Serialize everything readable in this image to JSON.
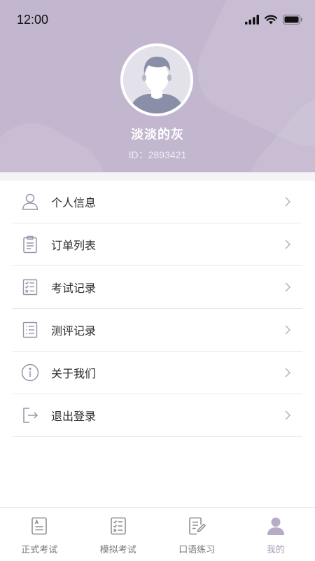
{
  "status_bar": {
    "time": "12:00"
  },
  "profile": {
    "username": "淡淡的灰",
    "user_id": "ID：2893421"
  },
  "menu": {
    "items": [
      {
        "label": "个人信息",
        "icon": "person-icon"
      },
      {
        "label": "订单列表",
        "icon": "clipboard-icon"
      },
      {
        "label": "考试记录",
        "icon": "checklist-icon"
      },
      {
        "label": "测评记录",
        "icon": "list-icon"
      },
      {
        "label": "关于我们",
        "icon": "info-icon"
      },
      {
        "label": "退出登录",
        "icon": "logout-icon"
      }
    ]
  },
  "tabbar": {
    "tabs": [
      {
        "label": "正式考试",
        "icon": "exam-paper-icon"
      },
      {
        "label": "模拟考试",
        "icon": "mock-exam-icon"
      },
      {
        "label": "口语练习",
        "icon": "speaking-practice-icon"
      },
      {
        "label": "我的",
        "icon": "profile-icon"
      }
    ],
    "active_index": 3
  },
  "colors": {
    "header_bg": "#c3b7cf",
    "accent": "#a798b8",
    "icon_stroke": "#9b92a8"
  }
}
